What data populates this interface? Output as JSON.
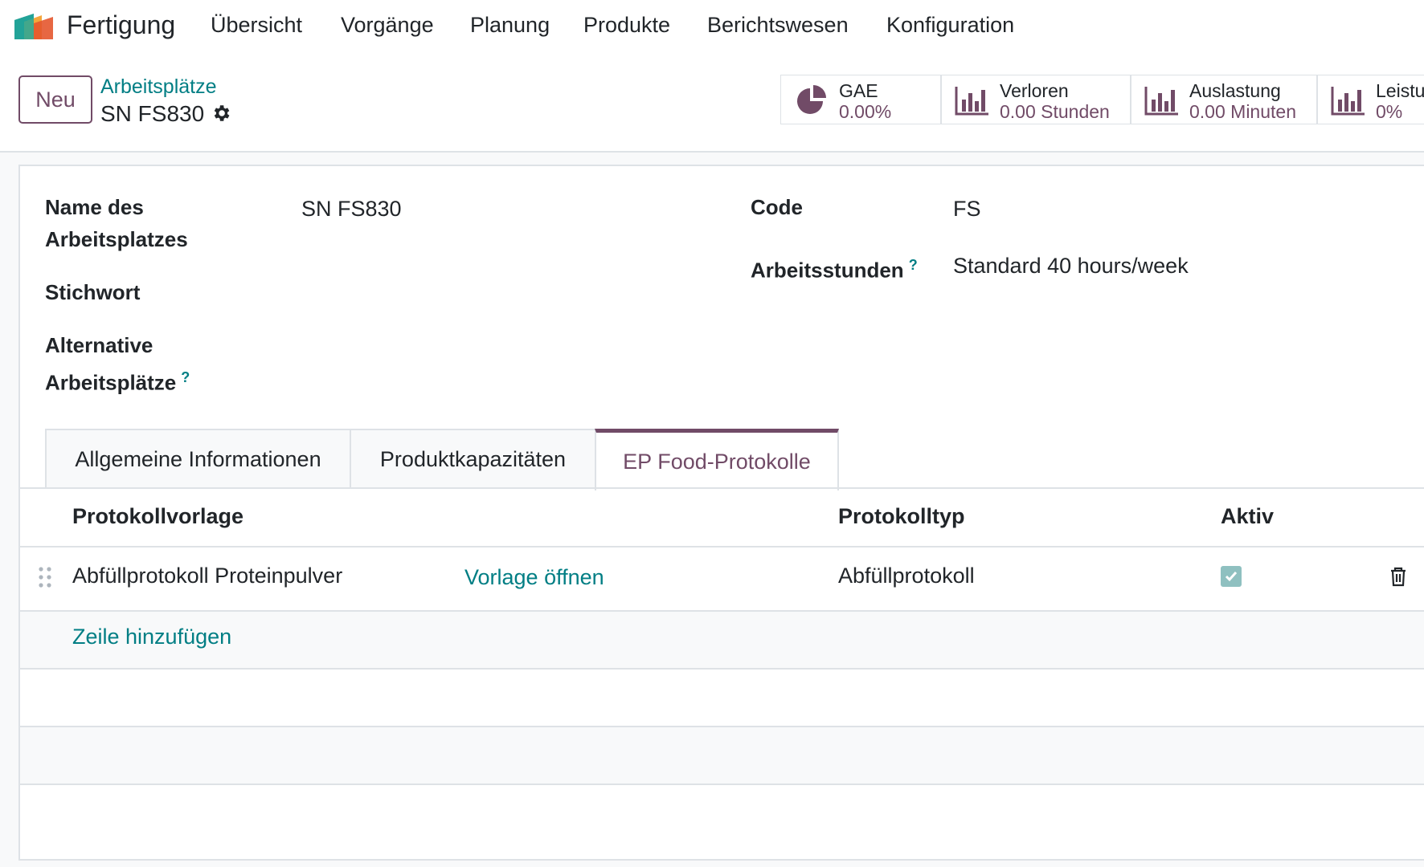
{
  "app": {
    "title": "Fertigung"
  },
  "menu": [
    "Übersicht",
    "Vorgänge",
    "Planung",
    "Produkte",
    "Berichtswesen",
    "Konfiguration"
  ],
  "control": {
    "new_label": "Neu",
    "breadcrumb": "Arbeitsplätze",
    "record_title": "SN FS830"
  },
  "stats": [
    {
      "label": "GAE",
      "value": "0.00%",
      "icon": "pie-chart-icon"
    },
    {
      "label": "Verloren",
      "value": "0.00 Stunden",
      "icon": "bar-chart-icon"
    },
    {
      "label": "Auslastung",
      "value": "0.00 Minuten",
      "icon": "bar-chart-icon"
    },
    {
      "label": "Leistung",
      "value": "0%",
      "icon": "bar-chart-icon"
    }
  ],
  "form": {
    "name_label_1": "Name des",
    "name_label_2": "Arbeitsplatzes",
    "name_value": "SN FS830",
    "keyword_label": "Stichwort",
    "alt_label_1": "Alternative",
    "alt_label_2": "Arbeitsplätze",
    "code_label": "Code",
    "code_value": "FS",
    "hours_label": "Arbeitsstunden",
    "hours_value": "Standard 40 hours/week",
    "help_mark": "?"
  },
  "tabs": [
    "Allgemeine Informationen",
    "Produktkapazitäten",
    "EP Food-Protokolle"
  ],
  "table": {
    "headers": [
      "Protokollvorlage",
      "Protokolltyp",
      "Aktiv"
    ],
    "rows": [
      {
        "template": "Abfüllprotokoll Proteinpulver",
        "open_label": "Vorlage öffnen",
        "type": "Abfüllprotokoll",
        "active": true
      }
    ],
    "add_line": "Zeile hinzufügen"
  },
  "colors": {
    "brand": "#714b67",
    "link": "#017e84",
    "border": "#dee2e6"
  }
}
